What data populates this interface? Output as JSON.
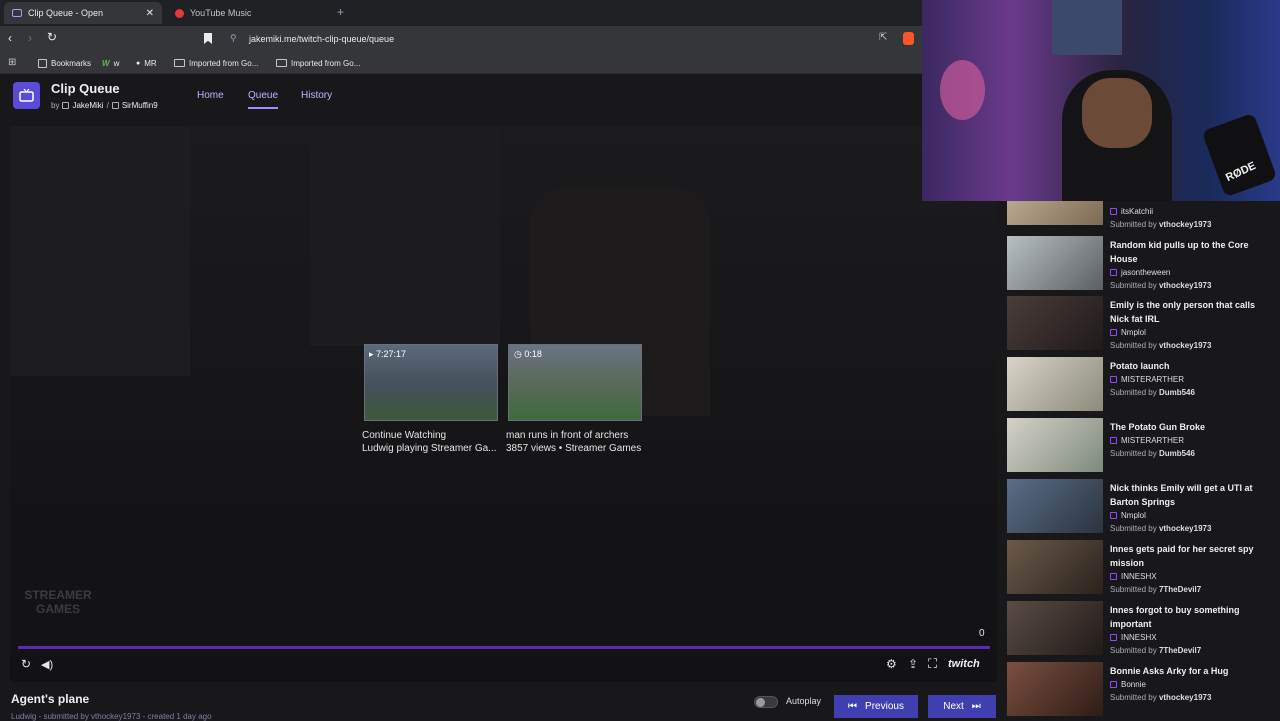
{
  "browser": {
    "tabs": [
      {
        "title": "Clip Queue - Open",
        "active": true
      },
      {
        "title": "YouTube Music",
        "active": false
      }
    ],
    "url": "jakemiki.me/twitch-clip-queue/queue",
    "bookmarks": [
      "Bookmarks",
      "w",
      "MR",
      "Imported from Go...",
      "Imported from Go..."
    ]
  },
  "app": {
    "title": "Clip Queue",
    "by": "by",
    "author1": "JakeMiki",
    "separator": "/",
    "author2": "SirMuffin9",
    "nav": [
      "Home",
      "Queue",
      "History"
    ]
  },
  "player": {
    "cards": [
      {
        "duration": "7:27:17",
        "line1": "Continue Watching",
        "line2": "Ludwig playing Streamer Ga..."
      },
      {
        "duration": "0:18",
        "line1": "man runs in front of archers",
        "line2": "3857 views • Streamer Games"
      }
    ],
    "counter": "0",
    "brand": "twitch",
    "watermark": "STREAMER GAMES"
  },
  "clip": {
    "title": "Agent's plane",
    "meta": "Ludwig - submitted by vthockey1973 - created 1 day ago"
  },
  "controls": {
    "autoplay": "Autoplay",
    "previous": "Previous",
    "next": "Next"
  },
  "queue": [
    {
      "title": "",
      "channel": "itsKatchii",
      "submitter": "vthockey1973"
    },
    {
      "title": "Random kid pulls up to the Core House",
      "channel": "jasontheween",
      "submitter": "vthockey1973"
    },
    {
      "title": "Emily is the only person that calls Nick fat IRL",
      "channel": "Nmplol",
      "submitter": "vthockey1973"
    },
    {
      "title": "Potato launch",
      "channel": "MISTERARTHER",
      "submitter": "Dumb546"
    },
    {
      "title": "The Potato Gun Broke",
      "channel": "MISTERARTHER",
      "submitter": "Dumb546"
    },
    {
      "title": "Nick thinks Emily will get a UTI at Barton Springs",
      "channel": "Nmplol",
      "submitter": "vthockey1973"
    },
    {
      "title": "Innes gets paid for her secret spy mission",
      "channel": "INNESHX",
      "submitter": "7TheDevil7"
    },
    {
      "title": "Innes forgot to buy something important",
      "channel": "INNESHX",
      "submitter": "7TheDevil7"
    },
    {
      "title": "Bonnie Asks Arky for a Hug",
      "channel": "Bonnie",
      "submitter": "vthockey1973"
    }
  ],
  "submitted_by_label": "Submitted by",
  "webcam": {
    "mic_brand": "RØDE"
  },
  "colors": {
    "accent": "#9147ff",
    "button": "#3f3fb0",
    "nav": "#bfb3ff"
  }
}
